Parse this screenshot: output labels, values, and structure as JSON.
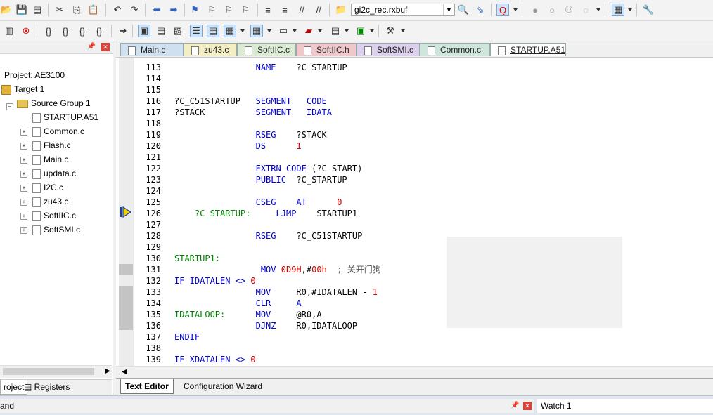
{
  "toolbar": {
    "target_name": "gi2c_rec.rxbuf"
  },
  "project_panel": {
    "root": "Project: AE3100",
    "target": "Target 1",
    "group": "Source Group 1",
    "files": [
      "STARTUP.A51",
      "Common.c",
      "Flash.c",
      "Main.c",
      "updata.c",
      "I2C.c",
      "zu43.c",
      "SoftIIC.c",
      "SoftSMI.c"
    ],
    "tab_project": "roject",
    "tab_registers": "Registers"
  },
  "editor_tabs": [
    {
      "label": "Main.c",
      "color": "#cfe0f0"
    },
    {
      "label": "zu43.c",
      "color": "#f4eec4"
    },
    {
      "label": "SoftIIC.c",
      "color": "#dcecd4"
    },
    {
      "label": "SoftIIC.h",
      "color": "#f0c8cc"
    },
    {
      "label": "SoftSMI.c",
      "color": "#dcd0ec"
    },
    {
      "label": "Common.c",
      "color": "#cfe6dc"
    },
    {
      "label": "STARTUP.A51",
      "color": "#ffffff"
    }
  ],
  "code_lines": [
    {
      "n": "113",
      "t": "                NAME    ?C_STARTUP"
    },
    {
      "n": "114",
      "t": ""
    },
    {
      "n": "115",
      "t": ""
    },
    {
      "n": "116",
      "t": "?C_C51STARTUP   SEGMENT   CODE"
    },
    {
      "n": "117",
      "t": "?STACK          SEGMENT   IDATA"
    },
    {
      "n": "118",
      "t": ""
    },
    {
      "n": "119",
      "t": "                RSEG    ?STACK"
    },
    {
      "n": "120",
      "t": "                DS      1"
    },
    {
      "n": "121",
      "t": ""
    },
    {
      "n": "122",
      "t": "                EXTRN CODE (?C_START)"
    },
    {
      "n": "123",
      "t": "                PUBLIC  ?C_STARTUP"
    },
    {
      "n": "124",
      "t": ""
    },
    {
      "n": "125",
      "t": "                CSEG    AT      0"
    },
    {
      "n": "126",
      "t": "    ?C_STARTUP:     LJMP    STARTUP1"
    },
    {
      "n": "127",
      "t": ""
    },
    {
      "n": "128",
      "t": "                RSEG    ?C_C51STARTUP"
    },
    {
      "n": "129",
      "t": ""
    },
    {
      "n": "130",
      "t": "STARTUP1:"
    },
    {
      "n": "131",
      "t": "                 MOV 0D9H,#00h  ; 关开门狗"
    },
    {
      "n": "132",
      "t": "IF IDATALEN <> 0"
    },
    {
      "n": "133",
      "t": "                MOV     R0,#IDATALEN - 1"
    },
    {
      "n": "134",
      "t": "                CLR     A"
    },
    {
      "n": "135",
      "t": "IDATALOOP:      MOV     @R0,A"
    },
    {
      "n": "136",
      "t": "                DJNZ    R0,IDATALOOP"
    },
    {
      "n": "137",
      "t": "ENDIF"
    },
    {
      "n": "138",
      "t": ""
    },
    {
      "n": "139",
      "t": "IF XDATALEN <> 0"
    }
  ],
  "code_parts": {
    "l113a": "NAME",
    "l113b": "?C_STARTUP",
    "l116a": "?C_C51STARTUP",
    "l116b": "SEGMENT",
    "l116c": "CODE",
    "l117a": "?STACK",
    "l117b": "SEGMENT",
    "l117c": "IDATA",
    "l119a": "RSEG",
    "l119b": "?STACK",
    "l120a": "DS",
    "l120b": "1",
    "l122a": "EXTRN",
    "l122b": "CODE",
    "l122c": "(?C_START)",
    "l123a": "PUBLIC",
    "l123b": "?C_STARTUP",
    "l125a": "CSEG",
    "l125b": "AT",
    "l125c": "0",
    "l126a": "?C_STARTUP:",
    "l126b": "LJMP",
    "l126c": "STARTUP1",
    "l128a": "RSEG",
    "l128b": "?C_C51STARTUP",
    "l130a": "STARTUP1:",
    "l131a": "MOV",
    "l131b": "0D9H",
    "l131c": ",#",
    "l131d": "00h",
    "l131e": "; 关开门狗",
    "l132a": "IF IDATALEN <> ",
    "l132b": "0",
    "l133a": "MOV",
    "l133b": "R0,#IDATALEN - ",
    "l133c": "1",
    "l134a": "CLR",
    "l134b": "A",
    "l135a": "IDATALOOP:",
    "l135b": "MOV",
    "l135c": "@R0,A",
    "l136a": "DJNZ",
    "l136b": "R0,IDATALOOP",
    "l137a": "ENDIF",
    "l139a": "IF XDATALEN <> ",
    "l139b": "0"
  },
  "editor_bottom_tabs": {
    "text_editor": "Text Editor",
    "config_wizard": "Configuration Wizard"
  },
  "bottom": {
    "left_pane": "and",
    "watch_pane": "Watch 1"
  }
}
